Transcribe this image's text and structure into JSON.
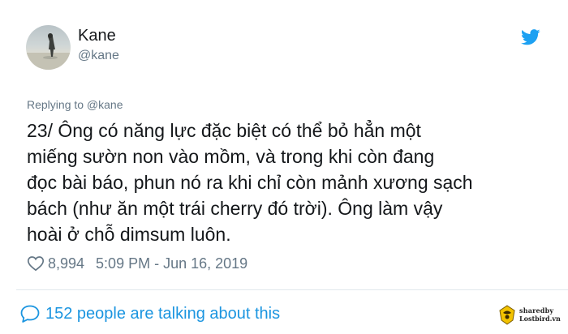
{
  "user": {
    "display_name": "Kane",
    "handle": "@kane"
  },
  "reply": {
    "text": "Replying to @kane"
  },
  "tweet": {
    "lines": [
      "23/ Ông có năng lực đặc biệt có thể bỏ hẳn một",
      "miếng sườn non vào mồm, và trong khi còn đang",
      "đọc bài báo, phun nó ra khi chỉ còn mảnh xương sạch",
      "bách (như ăn một trái cherry đó trời). Ông làm vậy",
      "hoài ở chỗ dimsum luôn."
    ]
  },
  "meta": {
    "like_count": "8,994",
    "timestamp": "5:09 PM - Jun 16, 2019"
  },
  "footer": {
    "talking_text": "152 people are talking about this"
  },
  "watermark": {
    "line1": "sharedby",
    "line2": "Lostbird.vn"
  },
  "icons": {
    "brand": "twitter-bird-icon",
    "like": "heart-icon",
    "conversation": "speech-bubble-icon"
  },
  "colors": {
    "twitter_blue": "#1da1f2",
    "link_blue": "#1b95e0",
    "secondary_text": "#657786",
    "primary_text": "#14171a",
    "divider": "#e1e8ed"
  }
}
